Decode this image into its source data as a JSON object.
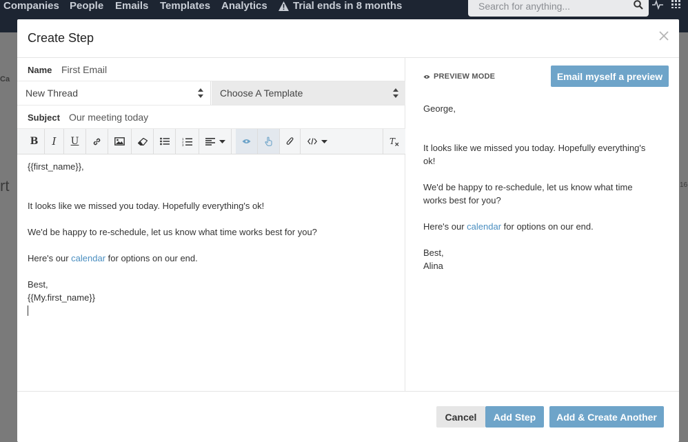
{
  "topnav": {
    "items": [
      "Companies",
      "People",
      "Emails",
      "Templates",
      "Analytics"
    ],
    "trial_text": "Trial ends in 8 months",
    "search_placeholder": "Search for anything..."
  },
  "background": {
    "breadcrumb_frag": "Ca",
    "title_frag": "rt",
    "right_frag": "16-"
  },
  "modal": {
    "title": "Create Step",
    "name_label": "Name",
    "name_value": "First Email",
    "thread_select": "New Thread",
    "template_select": "Choose A Template",
    "subject_label": "Subject",
    "subject_value": "Our meeting today"
  },
  "toolbar": {
    "buttons": [
      "bold",
      "italic",
      "underline",
      "link",
      "image",
      "eraser",
      "bullet-list",
      "numbered-list",
      "align",
      "preview-eye",
      "pointer-hand",
      "attachment",
      "code",
      "clear-format"
    ]
  },
  "editor": {
    "line1": "{{first_name}},",
    "line2": "It looks like we missed you today. Hopefully everything's ok!",
    "line3": "We'd be happy to re-schedule, let us know what time works best for you?",
    "line4_pre": "Here's our ",
    "line4_link": "calendar",
    "line4_post": " for options on our end.",
    "line5": "Best,",
    "line6": "{{My.first_name}}"
  },
  "preview": {
    "mode_label": "PREVIEW MODE",
    "email_button": "Email myself a preview",
    "greeting": "George,",
    "para1a": "It looks like we missed you today. Hopefully everything's",
    "para1b": "ok!",
    "para2a": "We'd be happy to re-schedule, let us know what time",
    "para2b": "works best for you?",
    "para3_pre": "Here's our ",
    "para3_link": "calendar",
    "para3_post": " for options on our end.",
    "signoff": "Best,",
    "sender": "Alina"
  },
  "footer": {
    "cancel": "Cancel",
    "add_step": "Add Step",
    "add_create": "Add & Create Another"
  },
  "colors": {
    "accent": "#6ea4c9",
    "link": "#4a8ec0",
    "nav_bg": "#1d2532"
  }
}
